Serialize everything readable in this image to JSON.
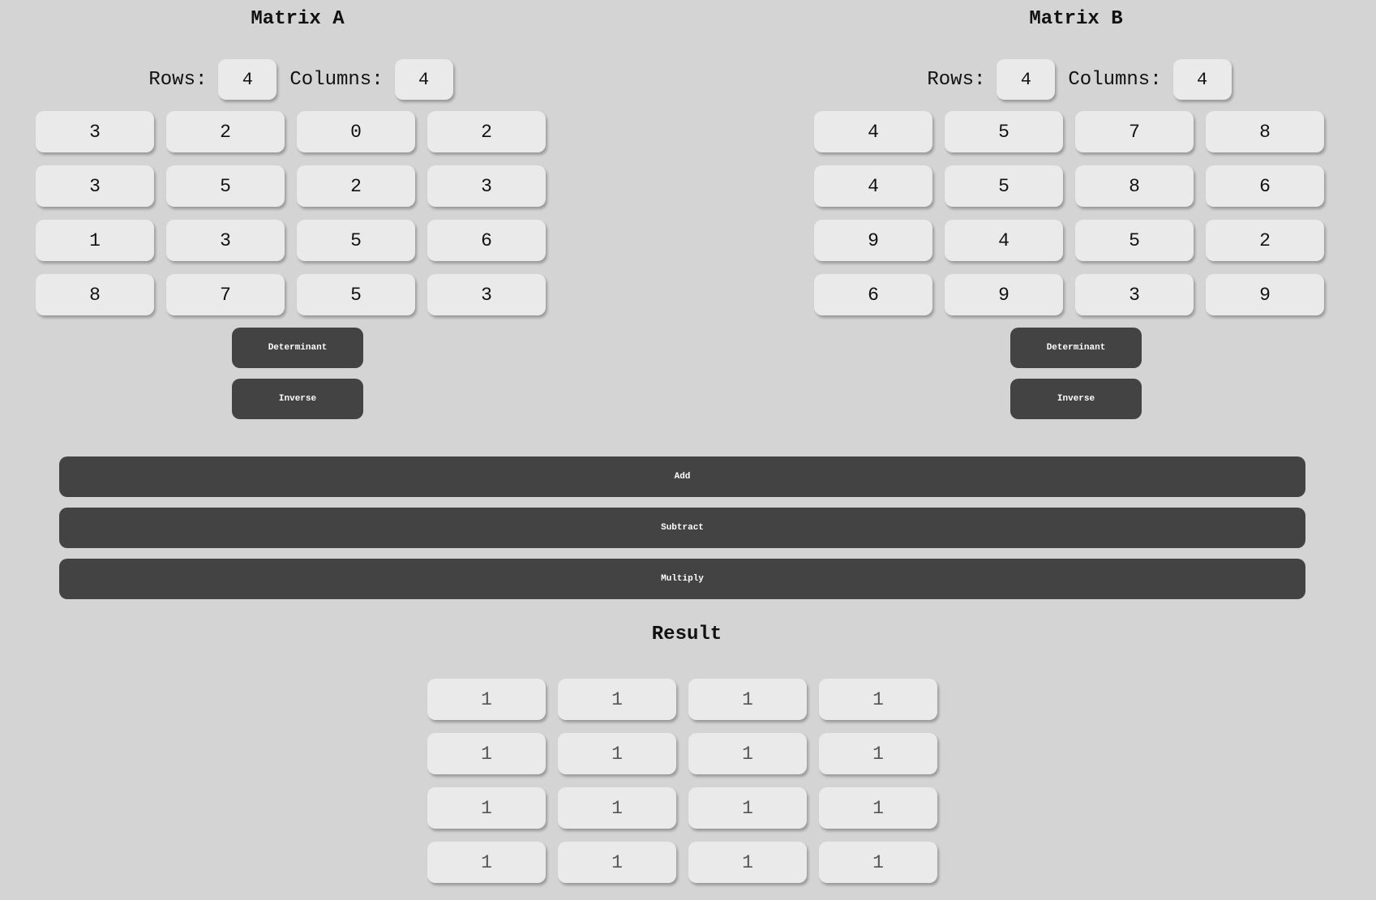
{
  "matrix_a": {
    "title": "Matrix A",
    "rows_label": "Rows:",
    "columns_label": "Columns:",
    "rows": "4",
    "columns": "4",
    "values": [
      [
        "3",
        "2",
        "0",
        "2"
      ],
      [
        "3",
        "5",
        "2",
        "3"
      ],
      [
        "1",
        "3",
        "5",
        "6"
      ],
      [
        "8",
        "7",
        "5",
        "3"
      ]
    ],
    "determinant_label": "Determinant",
    "inverse_label": "Inverse"
  },
  "matrix_b": {
    "title": "Matrix B",
    "rows_label": "Rows:",
    "columns_label": "Columns:",
    "rows": "4",
    "columns": "4",
    "values": [
      [
        "4",
        "5",
        "7",
        "8"
      ],
      [
        "4",
        "5",
        "8",
        "6"
      ],
      [
        "9",
        "4",
        "5",
        "2"
      ],
      [
        "6",
        "9",
        "3",
        "9"
      ]
    ],
    "determinant_label": "Determinant",
    "inverse_label": "Inverse"
  },
  "operations": {
    "add_label": "Add",
    "subtract_label": "Subtract",
    "multiply_label": "Multiply"
  },
  "result": {
    "title": "Result",
    "values": [
      [
        "1",
        "1",
        "1",
        "1"
      ],
      [
        "1",
        "1",
        "1",
        "1"
      ],
      [
        "1",
        "1",
        "1",
        "1"
      ],
      [
        "1",
        "1",
        "1",
        "1"
      ]
    ]
  },
  "colors": {
    "background": "#d4d4d4",
    "cell_background": "#eaeaea",
    "button_background": "#434343",
    "button_text": "#ffffff"
  }
}
